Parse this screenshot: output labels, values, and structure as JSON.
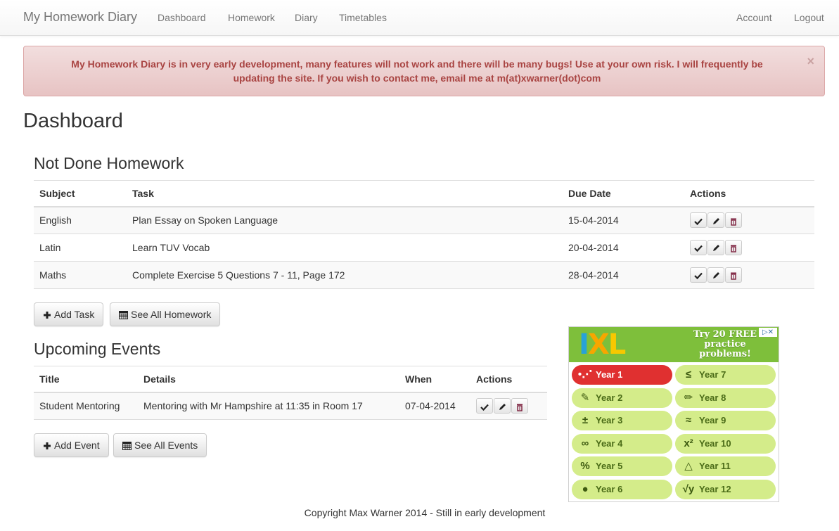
{
  "navbar": {
    "brand": "My Homework Diary",
    "links": [
      "Dashboard",
      "Homework",
      "Diary",
      "Timetables"
    ],
    "right_links": [
      "Account",
      "Logout"
    ]
  },
  "alert": {
    "message": "My Homework Diary is in very early development, many features will not work and there will be many bugs! Use at your own risk. I will frequently be updating the site. If you wish to contact me, email me at m(at)xwarner(dot)com",
    "close": "×"
  },
  "page_title": "Dashboard",
  "homework": {
    "heading": "Not Done Homework",
    "columns": [
      "Subject",
      "Task",
      "Due Date",
      "Actions"
    ],
    "rows": [
      {
        "subject": "English",
        "task": "Plan Essay on Spoken Language",
        "due": "15-04-2014"
      },
      {
        "subject": "Latin",
        "task": "Learn TUV Vocab",
        "due": "20-04-2014"
      },
      {
        "subject": "Maths",
        "task": "Complete Exercise 5 Questions 7 - 11, Page 172",
        "due": "28-04-2014"
      }
    ],
    "add_button": "Add Task",
    "see_all_button": "See All Homework"
  },
  "events": {
    "heading": "Upcoming Events",
    "columns": [
      "Title",
      "Details",
      "When",
      "Actions"
    ],
    "rows": [
      {
        "title": "Student Mentoring",
        "details": "Mentoring with Mr Hampshire at 11:35 in Room 17",
        "when": "07-04-2014"
      }
    ],
    "add_button": "Add Event",
    "see_all_button": "See All Events"
  },
  "ad": {
    "logo": [
      "I",
      "X",
      "L"
    ],
    "promo": "Try 20 FREE practice problems!",
    "years": [
      {
        "label": "Year 1",
        "icon": "dots-icon",
        "glyph": "•⋰",
        "active": true
      },
      {
        "label": "Year 7",
        "icon": "less-equal-icon",
        "glyph": "≤",
        "active": false
      },
      {
        "label": "Year 2",
        "icon": "pencil-cup-icon",
        "glyph": "✎",
        "active": false
      },
      {
        "label": "Year 8",
        "icon": "pencil-icon",
        "glyph": "✏",
        "active": false
      },
      {
        "label": "Year 3",
        "icon": "plus-minus-icon",
        "glyph": "±",
        "active": false
      },
      {
        "label": "Year 9",
        "icon": "approx-icon",
        "glyph": "≈",
        "active": false
      },
      {
        "label": "Year 4",
        "icon": "infinity-icon",
        "glyph": "∞",
        "active": false
      },
      {
        "label": "Year 10",
        "icon": "x-squared-icon",
        "glyph": "x²",
        "active": false
      },
      {
        "label": "Year 5",
        "icon": "percent-icon",
        "glyph": "%",
        "active": false
      },
      {
        "label": "Year 11",
        "icon": "triangle-icon",
        "glyph": "△",
        "active": false
      },
      {
        "label": "Year 6",
        "icon": "apple-icon",
        "glyph": "●",
        "active": false
      },
      {
        "label": "Year 12",
        "icon": "sqrt-icon",
        "glyph": "√y",
        "active": false
      }
    ]
  },
  "footer": "Copyright Max Warner 2014 - Still in early development",
  "colors": {
    "alert_text": "#a94442",
    "ad_green": "#7ebf3b",
    "year_active": "#e03030",
    "year_bg": "#d4ec8a"
  }
}
